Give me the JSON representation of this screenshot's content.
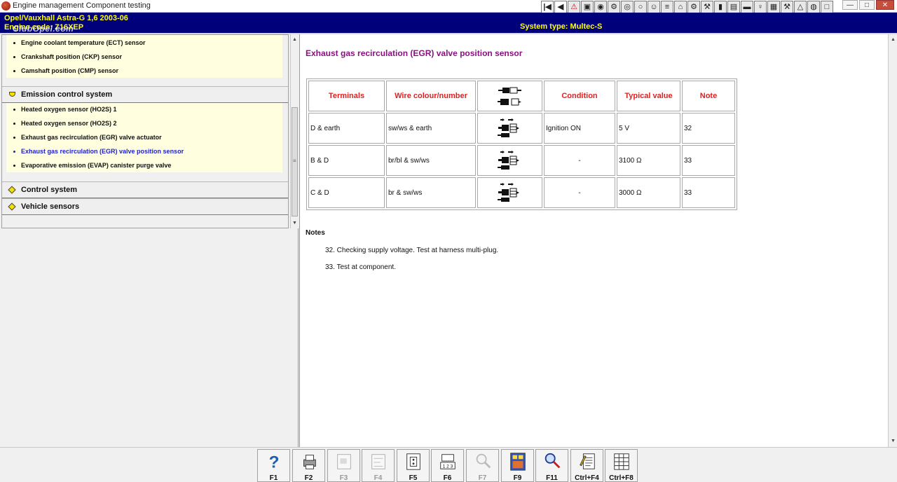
{
  "window": {
    "title": "Engine management Component testing",
    "controls": [
      "—",
      "□",
      "✕"
    ]
  },
  "toolbar": {
    "buttons": [
      {
        "name": "first-icon",
        "glyph": "|◀"
      },
      {
        "name": "prev-icon",
        "glyph": "◀"
      },
      {
        "name": "warning-icon",
        "glyph": "⚠",
        "color": "#d01010"
      },
      {
        "name": "book-icon",
        "glyph": "▣"
      },
      {
        "name": "gauge-icon",
        "glyph": "◉"
      },
      {
        "name": "engine-icon",
        "glyph": "⚙"
      },
      {
        "name": "sensor-icon",
        "glyph": "◎"
      },
      {
        "name": "wheel-icon",
        "glyph": "○"
      },
      {
        "name": "person-icon",
        "glyph": "☺"
      },
      {
        "name": "ruler-icon",
        "glyph": "≡"
      },
      {
        "name": "lift-icon",
        "glyph": "⌂"
      },
      {
        "name": "gear-icon",
        "glyph": "⚙"
      },
      {
        "name": "tools-icon",
        "glyph": "⚒"
      },
      {
        "name": "battery-icon",
        "glyph": "▮"
      },
      {
        "name": "clipboard-icon",
        "glyph": "▤"
      },
      {
        "name": "car-icon",
        "glyph": "▬"
      },
      {
        "name": "key-icon",
        "glyph": "♀"
      },
      {
        "name": "printer-icon",
        "glyph": "▦"
      },
      {
        "name": "settings-icon",
        "glyph": "⚒"
      },
      {
        "name": "hazard-icon",
        "glyph": "△"
      },
      {
        "name": "tyre-icon",
        "glyph": "◍"
      },
      {
        "name": "exit-icon",
        "glyph": "□"
      }
    ]
  },
  "header": {
    "vehicle": "Opel/Vauxhall   Astra-G  1,6  2003-06",
    "engine": "Engine code: Z16XEP",
    "watermark": "ClubOpel.com",
    "system_type": "System type: Multec-S"
  },
  "tree": {
    "top_items": [
      "Engine coolant temperature (ECT) sensor",
      "Crankshaft position (CKP) sensor",
      "Camshaft position (CMP) sensor"
    ],
    "emission_category": "Emission control system",
    "emission_items": [
      "Heated oxygen sensor (HO2S) 1",
      "Heated oxygen sensor (HO2S) 2",
      "Exhaust gas recirculation (EGR) valve actuator",
      "Exhaust gas recirculation (EGR) valve position sensor",
      "Evaporative emission (EVAP) canister purge valve"
    ],
    "active_index": 3,
    "control_category": "Control system",
    "vehicle_category": "Vehicle sensors"
  },
  "content": {
    "title": "Exhaust gas recirculation (EGR) valve position sensor",
    "columns": [
      "Terminals",
      "Wire colour/number",
      "connector-state-icon",
      "Condition",
      "Typical value",
      "Note"
    ],
    "rows": [
      {
        "terminals": "D & earth",
        "wire": "sw/ws & earth",
        "condition": "Ignition ON",
        "value": "5 V",
        "note": "32"
      },
      {
        "terminals": "B & D",
        "wire": "br/bl & sw/ws",
        "condition": "-",
        "value": "3100 Ω",
        "note": "33"
      },
      {
        "terminals": "C & D",
        "wire": "br & sw/ws",
        "condition": "-",
        "value": "3000 Ω",
        "note": "33"
      }
    ],
    "notes_title": "Notes",
    "notes": [
      "32. Checking supply voltage. Test at harness multi-plug.",
      "33. Test at component."
    ]
  },
  "function_keys": [
    {
      "label": "F1",
      "name": "help-icon",
      "enabled": true
    },
    {
      "label": "F2",
      "name": "printer-icon",
      "enabled": true
    },
    {
      "label": "F3",
      "name": "component-location-icon",
      "enabled": false
    },
    {
      "label": "F4",
      "name": "wiring-diagram-icon",
      "enabled": false
    },
    {
      "label": "F5",
      "name": "connector-icon",
      "enabled": true
    },
    {
      "label": "F6",
      "name": "pinout-icon",
      "enabled": true
    },
    {
      "label": "F7",
      "name": "magnifier-icon",
      "enabled": false
    },
    {
      "label": "F9",
      "name": "display-icon",
      "enabled": true
    },
    {
      "label": "F11",
      "name": "search-icon",
      "enabled": true
    },
    {
      "label": "Ctrl+F4",
      "name": "notes-icon",
      "enabled": true
    },
    {
      "label": "Ctrl+F8",
      "name": "table-icon",
      "enabled": true
    }
  ]
}
